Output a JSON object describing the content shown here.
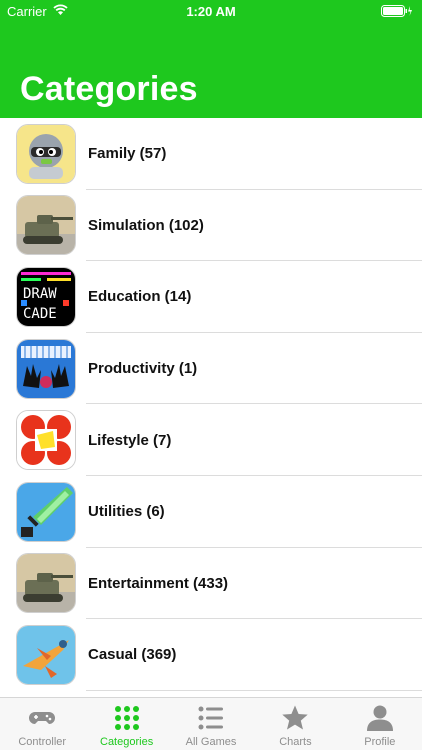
{
  "status_bar": {
    "carrier": "Carrier",
    "time": "1:20 AM"
  },
  "header": {
    "title": "Categories",
    "background_color": "#1ec81e"
  },
  "categories": [
    {
      "label": "Family (57)",
      "icon": "knight-game-icon"
    },
    {
      "label": "Simulation (102)",
      "icon": "tank-game-icon"
    },
    {
      "label": "Education (14)",
      "icon": "drawcade-pixel-icon"
    },
    {
      "label": "Productivity (1)",
      "icon": "hands-piano-icon"
    },
    {
      "label": "Lifestyle (7)",
      "icon": "red-yellow-puzzle-icon"
    },
    {
      "label": "Utilities (6)",
      "icon": "pixel-sword-icon"
    },
    {
      "label": "Entertainment (433)",
      "icon": "tank-game-icon"
    },
    {
      "label": "Casual (369)",
      "icon": "plane-game-icon"
    }
  ],
  "tab_bar": {
    "active_color": "#1ec81e",
    "inactive_color": "#8e8e8e",
    "tabs": [
      {
        "label": "Controller",
        "icon": "gamepad-icon",
        "active": false
      },
      {
        "label": "Categories",
        "icon": "grid-icon",
        "active": true
      },
      {
        "label": "All Games",
        "icon": "list-icon",
        "active": false
      },
      {
        "label": "Charts",
        "icon": "star-icon",
        "active": false
      },
      {
        "label": "Profile",
        "icon": "person-icon",
        "active": false
      }
    ]
  }
}
